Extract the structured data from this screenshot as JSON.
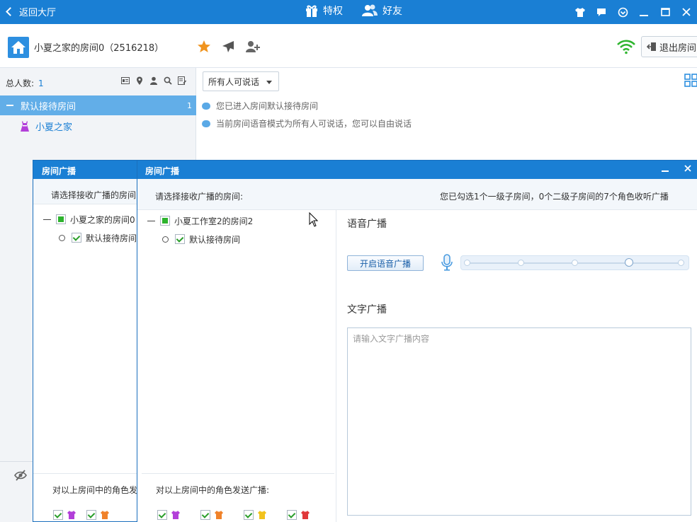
{
  "titlebar": {
    "back_label": "返回大厅",
    "privilege_label": "特权",
    "friends_label": "好友"
  },
  "room": {
    "name": "小夏之家的房间0（2516218）",
    "exit_label": "退出房间"
  },
  "left": {
    "count_label": "总人数:",
    "count_value": "1",
    "channel_label": "默认接待房间",
    "channel_count": "1",
    "user_name": "小夏之家"
  },
  "main": {
    "speak_mode": "所有人可说话",
    "messages": [
      "您已进入房间默认接待房间",
      "当前房间语音模式为所有人可说话，您可以自由说话"
    ]
  },
  "dialog_back": {
    "title": "房间广播",
    "prompt": "请选择接收广播的房间",
    "tree_root": "小夏之家的房间0",
    "tree_child": "默认接待房间",
    "footer": "对以上房间中的角色发"
  },
  "dialog_front": {
    "title": "房间广播",
    "prompt": "请选择接收广播的房间:",
    "summary": "您已勾选1个一级子房间，0个二级子房间的7个角色收听广播",
    "tree_root": "小夏工作室2的房间2",
    "tree_child": "默认接待房间",
    "footer": "对以上房间中的角色发送广播:",
    "voice_title": "语音广播",
    "voice_button": "开启语音广播",
    "text_title": "文字广播",
    "text_placeholder": "请输入文字广播内容"
  },
  "colors": {
    "accent": "#1a7fd4",
    "selected_row": "#62aee8",
    "role_purple": "#b23fd9",
    "role_orange": "#f0822a",
    "role_yellow": "#f2c21c",
    "role_red": "#e0383a"
  }
}
